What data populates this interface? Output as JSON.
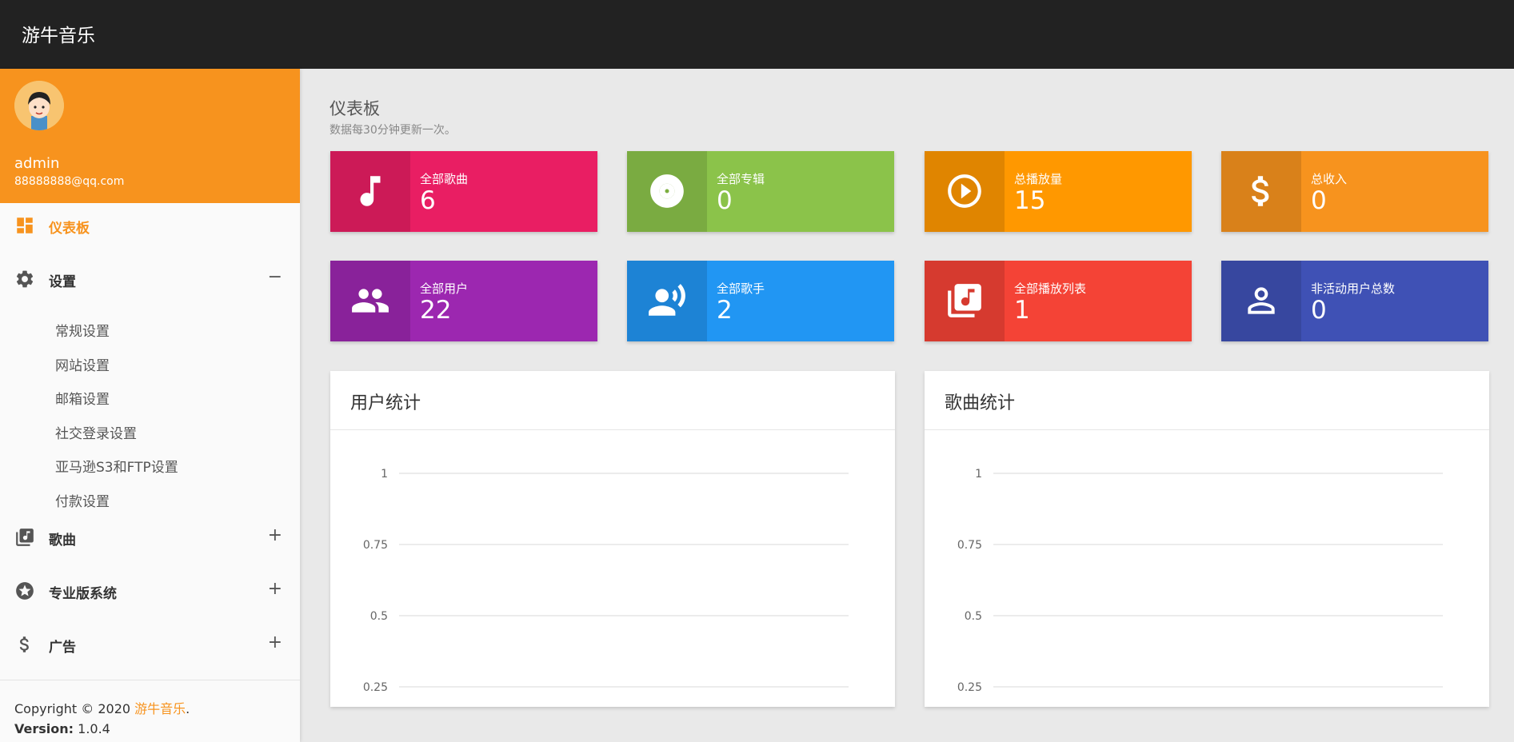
{
  "header": {
    "brand": "游牛音乐"
  },
  "user": {
    "name": "admin",
    "email": "88888888@qq.com"
  },
  "menu": {
    "dashboard": "仪表板",
    "settings": "设置",
    "settings_toggle": "−",
    "settings_items": [
      "常规设置",
      "网站设置",
      "邮箱设置",
      "社交登录设置",
      "亚马逊S3和FTP设置",
      "付款设置"
    ],
    "songs": "歌曲",
    "pro": "专业版系统",
    "ads": "广告",
    "plus": "+"
  },
  "footer": {
    "copyright_prefix": "Copyright © 2020 ",
    "copyright_link": "游牛音乐",
    "copyright_suffix": ".",
    "version_label": "Version:",
    "version_value": " 1.0.4"
  },
  "page": {
    "title": "仪表板",
    "subtitle": "数据每30分钟更新一次。"
  },
  "stats": [
    {
      "label": "全部歌曲",
      "value": "6",
      "color": "#e91e63",
      "icon": "music-note-icon"
    },
    {
      "label": "全部专辑",
      "value": "0",
      "color": "#8bc34a",
      "icon": "album-icon"
    },
    {
      "label": "总播放量",
      "value": "15",
      "color": "#ff9800",
      "icon": "play-circle-icon"
    },
    {
      "label": "总收入",
      "value": "0",
      "color": "#f7931e",
      "icon": "dollar-icon"
    },
    {
      "label": "全部用户",
      "value": "22",
      "color": "#9c27b0",
      "icon": "people-icon"
    },
    {
      "label": "全部歌手",
      "value": "2",
      "color": "#2196f3",
      "icon": "singer-icon"
    },
    {
      "label": "全部播放列表",
      "value": "1",
      "color": "#f44336",
      "icon": "playlist-icon"
    },
    {
      "label": "非活动用户总数",
      "value": "0",
      "color": "#3f51b5",
      "icon": "person-outline-icon"
    }
  ],
  "panels": {
    "users": "用户统计",
    "songs": "歌曲统计"
  },
  "chart_data": [
    {
      "type": "line",
      "title": "用户统计",
      "yticks": [
        "1",
        "0.75",
        "0.5",
        "0.25"
      ],
      "ylim": [
        0,
        1
      ],
      "series": []
    },
    {
      "type": "line",
      "title": "歌曲统计",
      "yticks": [
        "1",
        "0.75",
        "0.5",
        "0.25"
      ],
      "ylim": [
        0,
        1
      ],
      "series": []
    }
  ]
}
